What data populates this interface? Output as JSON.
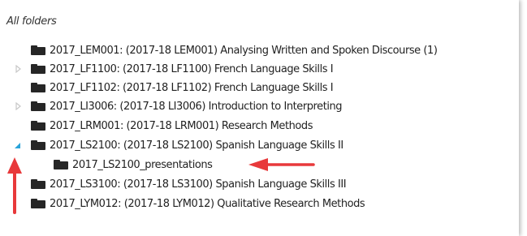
{
  "tree": {
    "header": "All folders",
    "rows": [
      {
        "label": "2017_LEM001: (2017-18 LEM001) Analysing Written and Spoken Discourse (1)",
        "toggle": "none",
        "icon": "folder-icon"
      },
      {
        "label": "2017_LF1100: (2017-18 LF1100) French Language Skills I",
        "toggle": "collapsed",
        "icon": "folder-icon"
      },
      {
        "label": "2017_LF1102: (2017-18 LF1102) French Language Skills I",
        "toggle": "none",
        "icon": "folder-icon"
      },
      {
        "label": "2017_LI3006: (2017-18 LI3006) Introduction to Interpreting",
        "toggle": "collapsed",
        "icon": "folder-icon"
      },
      {
        "label": "2017_LRM001: (2017-18 LRM001) Research Methods",
        "toggle": "none",
        "icon": "folder-icon"
      },
      {
        "label": "2017_LS2100: (2017-18 LS2100) Spanish Language Skills II",
        "toggle": "expanded",
        "icon": "folder-icon"
      },
      {
        "label": "2017_LS2100_presentations",
        "toggle": "none",
        "icon": "folder-icon",
        "child": true
      },
      {
        "label": "2017_LS3100: (2017-18 LS3100) Spanish Language Skills III",
        "toggle": "none",
        "icon": "folder-icon"
      },
      {
        "label": "2017_LYM012: (2017-18 LYM012) Qualitative Research Methods",
        "toggle": "none",
        "icon": "folder-icon"
      }
    ]
  },
  "colors": {
    "annotation_arrow": "#e8393b",
    "expanded_toggle": "#29a3d9",
    "collapsed_toggle": "#c8c8c8",
    "folder_icon": "#262626"
  }
}
